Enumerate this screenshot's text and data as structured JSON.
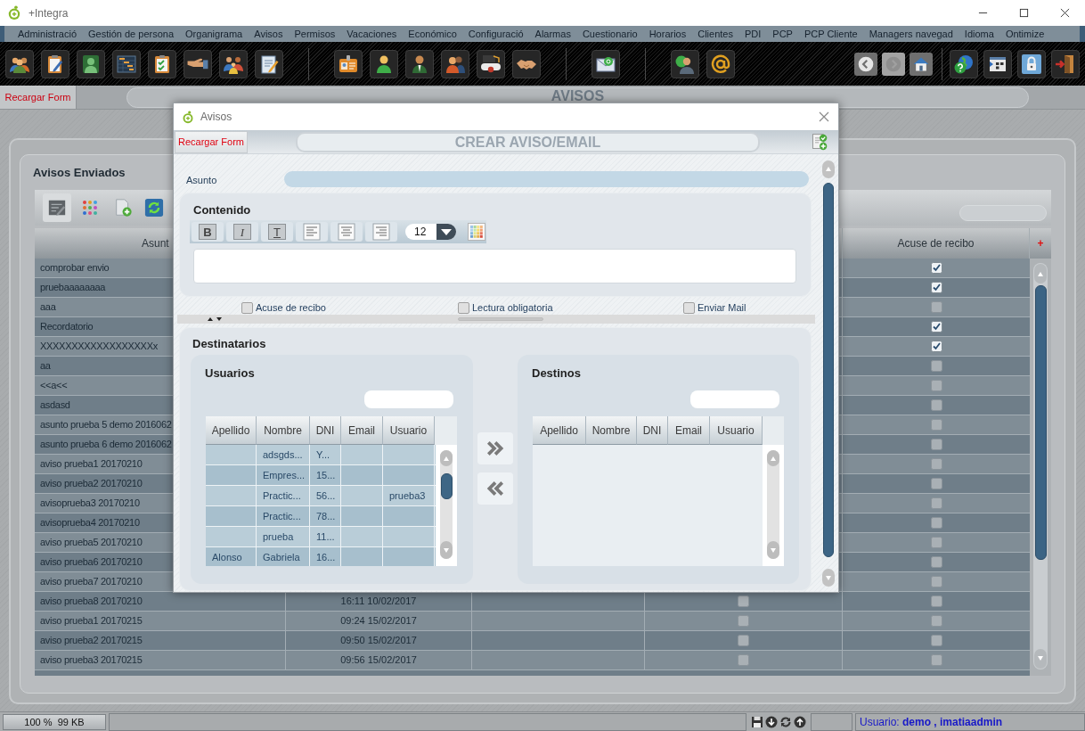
{
  "window": {
    "title": "+Integra"
  },
  "menu": [
    "Administració",
    "Gestión de persona",
    "Organigrama",
    "Avisos",
    "Permisos",
    "Vacaciones",
    "Económico",
    "Configuració",
    "Alarmas",
    "Cuestionario",
    "Horarios",
    "Clientes",
    "PDI",
    "PCP",
    "PCP Cliente",
    "Managers navegad",
    "Idioma",
    "Ontimize"
  ],
  "nav_buttons": [
    {
      "kind": "back",
      "disabled": false
    },
    {
      "kind": "forward",
      "disabled": true
    },
    {
      "kind": "home",
      "disabled": false
    }
  ],
  "form_header": {
    "reload_button": "Recargar Form",
    "title": "AVISOS"
  },
  "sent_panel": {
    "title": "Avisos Enviados",
    "table": {
      "header": {
        "asunto": "Asunt",
        "acuse_de_recibo": "Acuse de recibo"
      },
      "add_button": "+",
      "rows": [
        {
          "asunto": "comprobar envio",
          "acuse_de_recibo": true
        },
        {
          "asunto": "pruebaaaaaaaa",
          "acuse_de_recibo": true
        },
        {
          "asunto": "aaa",
          "acuse_de_recibo": false
        },
        {
          "asunto": "Recordatorio",
          "acuse_de_recibo": true
        },
        {
          "asunto": "XXXXXXXXXXXXXXXXXXx",
          "acuse_de_recibo": true
        },
        {
          "asunto": "aa",
          "acuse_de_recibo": false
        },
        {
          "asunto": "<<a<<",
          "acuse_de_recibo": false
        },
        {
          "asunto": "asdasd",
          "acuse_de_recibo": false
        },
        {
          "asunto": "asunto prueba 5 demo 2016062",
          "acuse_de_recibo": false
        },
        {
          "asunto": "asunto prueba 6 demo 2016062",
          "acuse_de_recibo": false
        },
        {
          "asunto": "aviso prueba1 20170210",
          "acuse_de_recibo": false
        },
        {
          "asunto": "aviso prueba2 20170210",
          "acuse_de_recibo": false
        },
        {
          "asunto": "avisoprueba3 20170210",
          "acuse_de_recibo": false
        },
        {
          "asunto": "avisoprueba4 20170210",
          "acuse_de_recibo": false
        },
        {
          "asunto": "aviso prueba5 20170210",
          "acuse_de_recibo": false
        },
        {
          "asunto": "aviso prueba6 20170210",
          "acuse_de_recibo": false
        },
        {
          "asunto": "aviso prueba7 20170210",
          "acuse_de_recibo": false
        },
        {
          "asunto": "aviso prueba8 20170210",
          "column_2": "16:11 10/02/2017",
          "column_4": false,
          "acuse_de_recibo": false
        },
        {
          "asunto": "aviso prueba1 20170215",
          "column_2": "09:24 15/02/2017",
          "column_4": false,
          "acuse_de_recibo": false
        },
        {
          "asunto": "aviso prueba2 20170215",
          "column_2": "09:50 15/02/2017",
          "column_4": false,
          "acuse_de_recibo": false
        },
        {
          "asunto": "aviso prueba3 20170215",
          "column_2": "09:56 15/02/2017",
          "column_4": false,
          "acuse_de_recibo": false
        }
      ]
    }
  },
  "dialog": {
    "title": "Avisos",
    "reload_button": "Recargar Form",
    "heading": "CREAR AVISO/EMAIL",
    "subject_label": "Asunto",
    "content": {
      "title": "Contenido",
      "format_buttons": [
        {
          "kind": "bold",
          "label": "B"
        },
        {
          "kind": "italic",
          "label": "I"
        },
        {
          "kind": "underline",
          "label": "T"
        }
      ],
      "font_size": "12"
    },
    "options": [
      {
        "label": "Acuse de recibo",
        "checked": false
      },
      {
        "label": "Lectura obligatoria",
        "checked": false
      },
      {
        "label": "Enviar Mail",
        "checked": false
      }
    ],
    "recipients": {
      "title": "Destinatarios",
      "users": {
        "title": "Usuarios",
        "columns": [
          "Apellido",
          "Nombre",
          "DNI",
          "Email",
          "Usuario"
        ],
        "rows": [
          {
            "nombre": "adsgds...",
            "dni": "Y..."
          },
          {
            "nombre": "Empres...",
            "dni": "15..."
          },
          {
            "nombre": "Practic...",
            "dni": "56...",
            "usuario": "prueba3"
          },
          {
            "nombre": "Practic...",
            "dni": "78..."
          },
          {
            "nombre": "prueba",
            "dni": "11..."
          },
          {
            "apellido": "Alonso",
            "nombre": "Gabriela",
            "dni": "16..."
          }
        ]
      },
      "targets": {
        "title": "Destinos",
        "columns": [
          "Apellido",
          "Nombre",
          "DNI",
          "Email",
          "Usuario"
        ]
      }
    }
  },
  "status_bar": {
    "memory": "100 %  99 KB",
    "user": "Usuario: **demo , imatiaadmin**"
  }
}
